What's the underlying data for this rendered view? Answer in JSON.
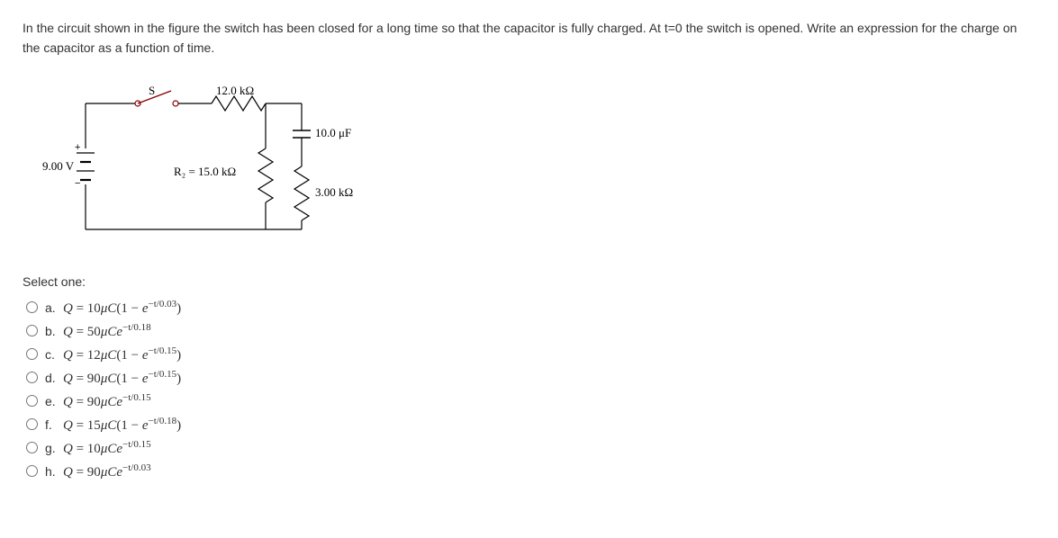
{
  "question": "In the circuit shown in the figure the switch has been closed for a long time so that the capacitor is fully charged. At t=0 the switch is opened. Write an expression for the charge on the capacitor as a function of time.",
  "circuit": {
    "switch_label": "S",
    "r1": "12.0 kΩ",
    "capacitor": "10.0 μF",
    "voltage": "9.00 V",
    "r2": "R₂ = 15.0 kΩ",
    "r3": "3.00 kΩ"
  },
  "select_label": "Select one:",
  "options": [
    {
      "letter": "a.",
      "html": "Q = 10μC(1 − e<span class='sup'>−t/0.03</span>)"
    },
    {
      "letter": "b.",
      "html": "Q = 50μCe<span class='sup'>−t/0.18</span>"
    },
    {
      "letter": "c.",
      "html": "Q = 12μC(1 − e<span class='sup'>−t/0.15</span>)"
    },
    {
      "letter": "d.",
      "html": "Q = 90μC(1 − e<span class='sup'>−t/0.15</span>)"
    },
    {
      "letter": "e.",
      "html": "Q = 90μCe<span class='sup'>−t/0.15</span>"
    },
    {
      "letter": "f.",
      "html": "Q = 15μC(1 − e<span class='sup'>−t/0.18</span>)"
    },
    {
      "letter": "g.",
      "html": "Q = 10μCe<span class='sup'>−t/0.15</span>"
    },
    {
      "letter": "h.",
      "html": "Q = 90μCe<span class='sup'>−t/0.03</span>"
    }
  ]
}
